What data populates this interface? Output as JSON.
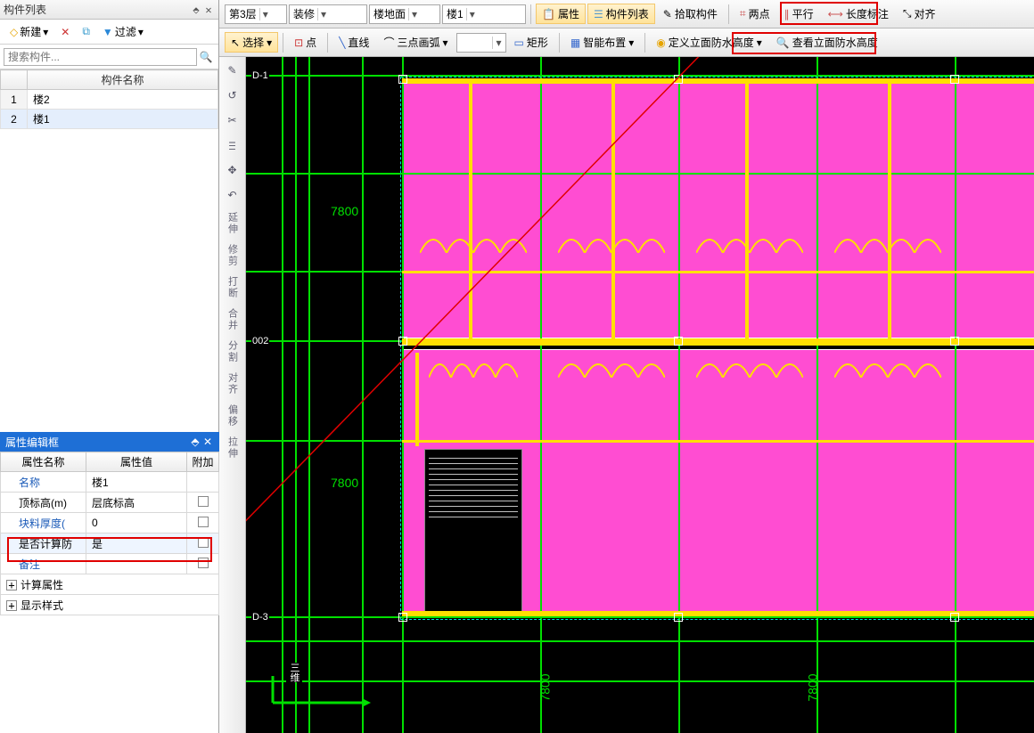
{
  "panels": {
    "component_list": {
      "title": "构件列表"
    },
    "property_editor": {
      "title": "属性编辑框"
    }
  },
  "component_toolbar": {
    "new_label": "新建",
    "filter_label": "过滤"
  },
  "search": {
    "placeholder": "搜索构件..."
  },
  "component_table": {
    "header": "构件名称",
    "rows": [
      {
        "idx": "1",
        "name": "楼2"
      },
      {
        "idx": "2",
        "name": "楼1"
      }
    ],
    "selected_index": 1
  },
  "property_table": {
    "headers": {
      "name": "属性名称",
      "value": "属性值",
      "extra": "附加"
    },
    "rows": [
      {
        "name": "名称",
        "value": "楼1",
        "blue": true
      },
      {
        "name": "顶标高(m)",
        "value": "层底标高"
      },
      {
        "name": "块料厚度(",
        "value": "0",
        "blue": true
      },
      {
        "name": "是否计算防",
        "value": "是",
        "highlight": true
      },
      {
        "name": "备注",
        "value": "",
        "blue": true
      }
    ],
    "groups": [
      {
        "label": "计算属性"
      },
      {
        "label": "显示样式"
      }
    ]
  },
  "ribbon_top": {
    "combo_floor": "第3层",
    "combo_category": "装修",
    "combo_subtype": "楼地面",
    "combo_item": "楼1",
    "btn_attrs": "属性",
    "btn_complist": "构件列表",
    "btn_pick": "拾取构件",
    "btn_twopoint": "两点",
    "btn_parallel": "平行",
    "btn_lendim": "长度标注",
    "btn_align": "对齐"
  },
  "ribbon_draw": {
    "btn_select": "选择",
    "btn_point": "点",
    "btn_line": "直线",
    "btn_arc3pt": "三点画弧",
    "btn_rect": "矩形",
    "btn_smart": "智能布置",
    "btn_define_wp": "定义立面防水高度",
    "btn_view_wp": "查看立面防水高度"
  },
  "vtools": {
    "labels": [
      "延伸",
      "修剪",
      "打断",
      "合并",
      "分割",
      "对齐",
      "偏移",
      "拉伸"
    ]
  },
  "canvas": {
    "dims": {
      "d1": "7800",
      "d2": "7800",
      "d3": "7800",
      "d4": "7800"
    },
    "grid_labels": {
      "left_top": "D-1",
      "left_mid": "002",
      "left_bot": "D-3",
      "view": "三维"
    }
  }
}
